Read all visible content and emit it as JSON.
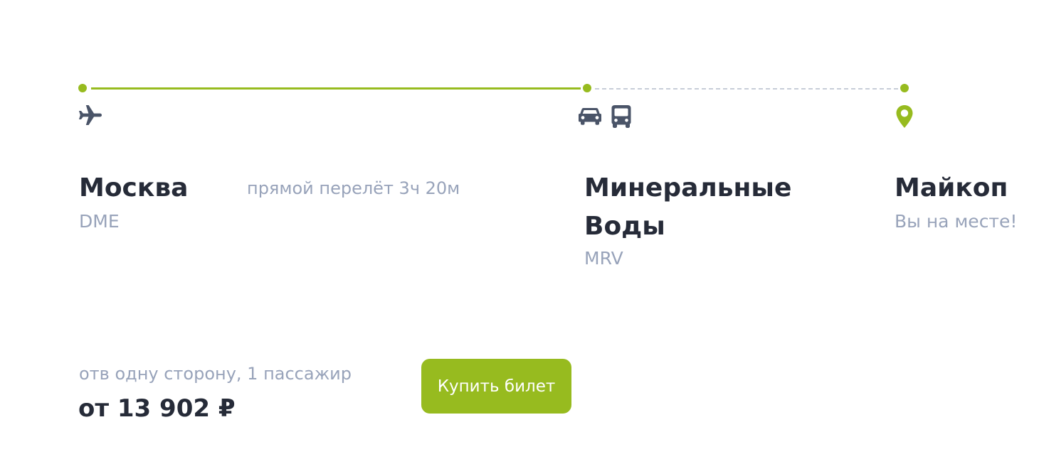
{
  "route": {
    "origin": {
      "city": "Москва",
      "code": "DME"
    },
    "flight_info": "прямой перелёт 3ч 20м",
    "transfer": {
      "city": "Минеральные Воды",
      "code": "MRV"
    },
    "destination": {
      "city": "Майкоп",
      "note": "Вы на месте!"
    },
    "icons": {
      "origin": "airplane-icon",
      "transfer": [
        "car-icon",
        "bus-icon"
      ],
      "destination": "map-pin-icon"
    }
  },
  "price": {
    "caption": "отв одну сторону, 1 пассажир",
    "value": "от 13 902 ₽"
  },
  "buy_button_label": "Купить билет",
  "colors": {
    "accent": "#97bb1f",
    "text": "#262b38",
    "muted": "#98a3ba",
    "icon": "#4a5468",
    "dashed": "#c7cdd8"
  }
}
